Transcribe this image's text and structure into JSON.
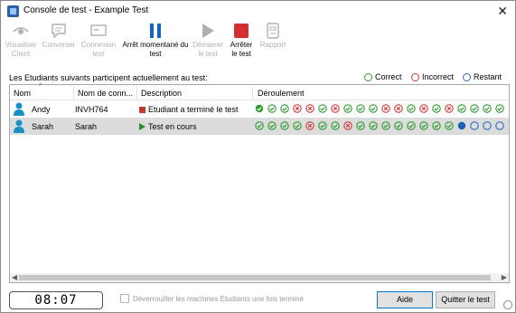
{
  "window": {
    "title": "Console de test - Example Test",
    "close_glyph": "✕"
  },
  "toolbar": [
    {
      "label": "Visualiser Client",
      "icon": "eye-icon",
      "enabled": false
    },
    {
      "label": "Converser",
      "icon": "chat-icon",
      "enabled": false
    },
    {
      "label": "Connexion test",
      "icon": "connection-icon",
      "enabled": false
    },
    {
      "label": "Arrêt momentané du test",
      "icon": "pause-icon",
      "enabled": true
    },
    {
      "label": "Démarrer le test",
      "icon": "play-icon",
      "enabled": false
    },
    {
      "label": "Arrêter le test",
      "icon": "stop-icon",
      "enabled": true
    },
    {
      "label": "Rapport",
      "icon": "report-icon",
      "enabled": false
    }
  ],
  "participants_label": "Les Etudiants suivants participent actuellement au test:",
  "legend": {
    "correct": "Correct",
    "incorrect": "Incorrect",
    "remaining": "Restant"
  },
  "columns": {
    "name": "Nom",
    "login": "Nom de conn...",
    "description": "Description",
    "progress": "Déroulement"
  },
  "rows": [
    {
      "name": "Andy",
      "login": "INVH764",
      "description": "Etudiant a terminé le test",
      "status": "finished",
      "progress": [
        "c",
        "c",
        "c",
        "i",
        "i",
        "c",
        "i",
        "c",
        "c",
        "c",
        "i",
        "i",
        "c",
        "i",
        "c",
        "i",
        "c",
        "c",
        "c",
        "c"
      ]
    },
    {
      "name": "Sarah",
      "login": "Sarah",
      "description": "Test en cours",
      "status": "running",
      "progress": [
        "c",
        "c",
        "c",
        "c",
        "i",
        "c",
        "c",
        "i",
        "c",
        "c",
        "c",
        "c",
        "c",
        "c",
        "c",
        "c",
        "a",
        "r",
        "r",
        "r"
      ]
    }
  ],
  "timer": "08:07",
  "unlock_checkbox": {
    "label": "Déverrouiller les machines Etudiants une fois terminé",
    "checked": false
  },
  "buttons": {
    "help": "Aide",
    "quit": "Quitter le test"
  },
  "colors": {
    "correct": "#2e9b2e",
    "incorrect": "#d23a3a",
    "remaining": "#2b6cc4",
    "active": "#1e5eb8",
    "pause": "#1565c0",
    "stop": "#d32f2f",
    "disabled": "#b0b0b0"
  }
}
